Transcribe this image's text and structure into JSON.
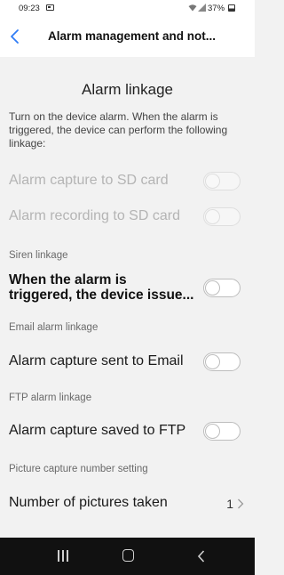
{
  "status_bar": {
    "time": "09:23",
    "battery": "37%"
  },
  "header": {
    "title": "Alarm management and not..."
  },
  "section": {
    "title": "Alarm linkage",
    "description": "Turn on the device alarm. When the alarm is triggered, the device can perform the following linkage:"
  },
  "settings": {
    "sd_capture": {
      "label": "Alarm capture to SD card",
      "enabled": false,
      "on": false
    },
    "sd_recording": {
      "label": "Alarm recording to SD card",
      "enabled": false,
      "on": false
    },
    "siren_header": "Siren linkage",
    "siren": {
      "label_line1": "When the alarm is",
      "label_line2": "triggered, the device issue...",
      "on": false
    },
    "email_header": "Email alarm linkage",
    "email": {
      "label": "Alarm capture sent to Email",
      "on": false
    },
    "ftp_header": "FTP alarm linkage",
    "ftp": {
      "label": "Alarm capture saved to FTP",
      "on": false
    },
    "pictures_header": "Picture capture number setting",
    "pictures": {
      "label": "Number of pictures taken",
      "value": "1"
    }
  },
  "colors": {
    "background": "#f2f2f2",
    "accent": "#2f7cf6",
    "system_nav": "#111111"
  }
}
